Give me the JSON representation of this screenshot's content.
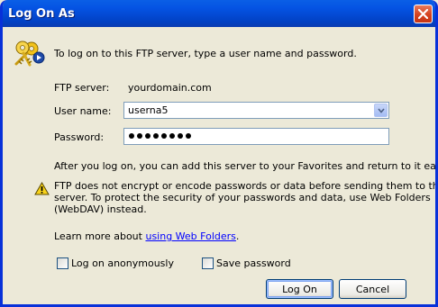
{
  "window": {
    "title": "Log On As"
  },
  "info_text": "To log on to this FTP server, type a user name and password.",
  "ftp_server": {
    "label": "FTP server:",
    "value": "yourdomain.com"
  },
  "user_name": {
    "label": "User name:",
    "value": "userna5"
  },
  "password": {
    "label": "Password:",
    "masked_length": 8
  },
  "favorites_text": "After you log on, you can add this server to your Favorites and return to it easily.",
  "warning": {
    "line1": "FTP does not encrypt or encode passwords or data before sending them to the",
    "line2": "server.  To protect the security of your passwords and data, use Web Folders",
    "line3": "(WebDAV) instead."
  },
  "learn_more": {
    "prefix": "Learn more about ",
    "link": "using Web Folders",
    "suffix": "."
  },
  "checkboxes": {
    "anonymous": "Log on anonymously",
    "save_password": "Save password"
  },
  "buttons": {
    "log_on": "Log On",
    "cancel": "Cancel"
  },
  "icons": {
    "title_close": "close-icon",
    "keys": "keys-icon",
    "warning": "warning-icon",
    "dropdown": "chevron-down-icon"
  },
  "colors": {
    "title_bar": "#0553e3",
    "dialog_bg": "#ece9d8",
    "link": "#0000ff",
    "close_button": "#d4421f"
  }
}
